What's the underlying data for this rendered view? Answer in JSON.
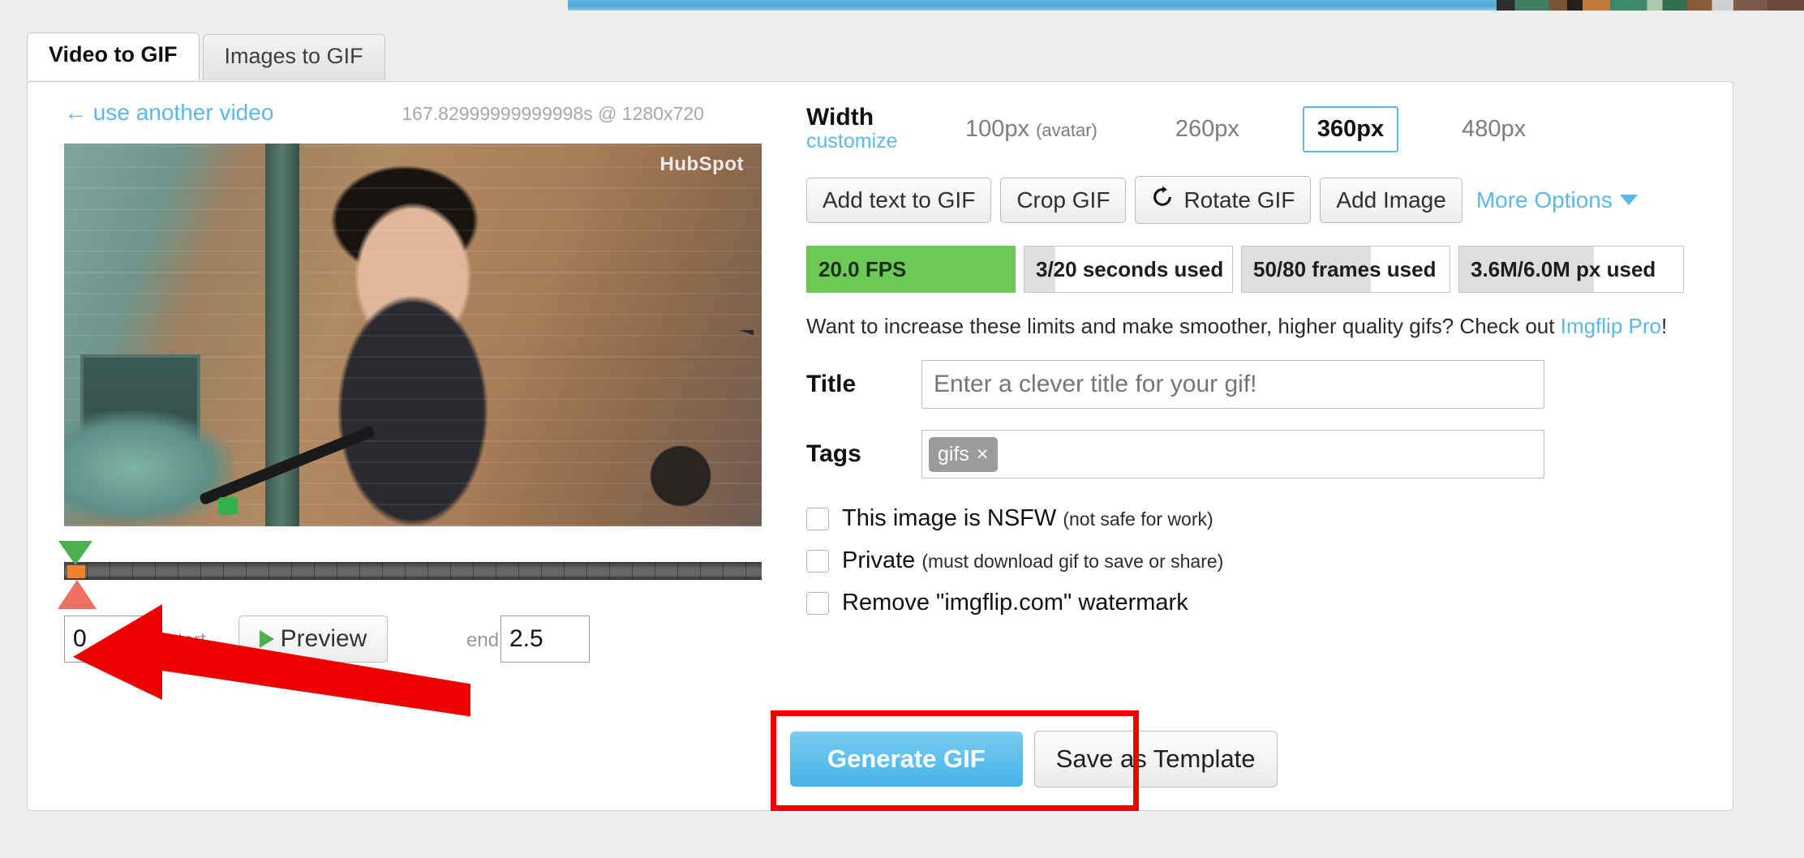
{
  "tabs": [
    {
      "label": "Video to GIF",
      "active": true
    },
    {
      "label": "Images to GIF",
      "active": false
    }
  ],
  "left": {
    "use_another_video": "← use another video",
    "video_meta": "167.82999999999998s @ 1280x720",
    "video_watermark": "HubSpot",
    "start_value": "0",
    "start_label": "start",
    "end_label": "end",
    "end_value": "2.5",
    "preview_label": "Preview"
  },
  "width": {
    "label": "Width",
    "customize": "customize",
    "options": [
      {
        "label": "100px",
        "note": "(avatar)",
        "selected": false
      },
      {
        "label": "260px",
        "note": "",
        "selected": false
      },
      {
        "label": "360px",
        "note": "",
        "selected": true
      },
      {
        "label": "480px",
        "note": "",
        "selected": false
      }
    ]
  },
  "toolbar": {
    "add_text": "Add text to GIF",
    "crop": "Crop GIF",
    "rotate": "Rotate GIF",
    "add_image": "Add Image",
    "more_options": "More Options"
  },
  "stats": [
    {
      "text": "20.0 FPS",
      "fill_pct": 100,
      "style": "green"
    },
    {
      "text": "3/20 seconds used",
      "fill_pct": 15,
      "style": "plain"
    },
    {
      "text": "50/80 frames used",
      "fill_pct": 62,
      "style": "plain"
    },
    {
      "text": "3.6M/6.0M px used",
      "fill_pct": 60,
      "style": "plain"
    }
  ],
  "promo": {
    "text": "Want to increase these limits and make smoother, higher quality gifs? Check out ",
    "link": "Imgflip Pro",
    "suffix": "!"
  },
  "fields": {
    "title_label": "Title",
    "title_value": "",
    "title_placeholder": "Enter a clever title for your gif!",
    "tags_label": "Tags",
    "tag_chip": "gifs",
    "tag_remove": "×"
  },
  "checkboxes": [
    {
      "label": "This image is NSFW ",
      "sub": "(not safe for work)",
      "checked": false
    },
    {
      "label": "Private ",
      "sub": "(must download gif to save or share)",
      "checked": false
    },
    {
      "label": "Remove \"imgflip.com\" watermark",
      "sub": "",
      "checked": false
    }
  ],
  "actions": {
    "generate": "Generate GIF",
    "save_template": "Save as Template"
  },
  "colors": {
    "accent_blue": "#5ab9e8",
    "green_fps": "#6ec857",
    "annotation_red": "#ee0000",
    "handle_start_green": "#4caf50",
    "handle_end_red": "#ef6f62",
    "sel_marker_orange": "#f0822c"
  }
}
